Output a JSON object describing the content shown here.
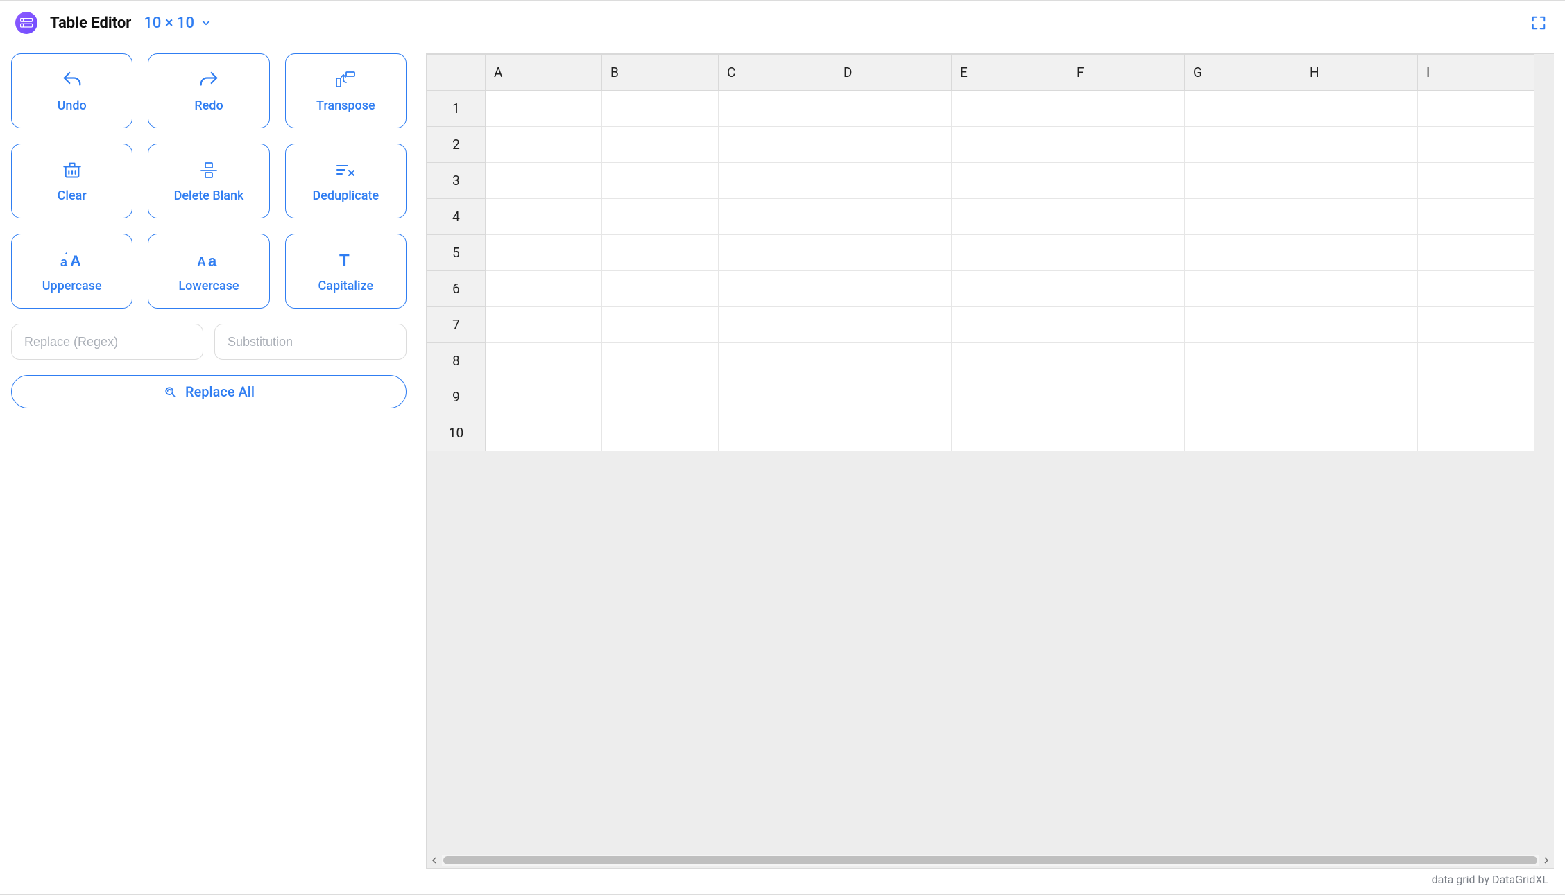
{
  "header": {
    "title": "Table Editor",
    "dims_label": "10 × 10"
  },
  "sidebar": {
    "buttons": {
      "undo": "Undo",
      "redo": "Redo",
      "transpose": "Transpose",
      "clear": "Clear",
      "delete_blank": "Delete Blank",
      "deduplicate": "Deduplicate",
      "uppercase": "Uppercase",
      "lowercase": "Lowercase",
      "capitalize": "Capitalize"
    },
    "replace": {
      "regex_placeholder": "Replace (Regex)",
      "substitution_placeholder": "Substitution",
      "replace_all_label": "Replace All"
    }
  },
  "grid": {
    "columns": [
      "A",
      "B",
      "C",
      "D",
      "E",
      "F",
      "G",
      "H",
      "I"
    ],
    "rows": [
      "1",
      "2",
      "3",
      "4",
      "5",
      "6",
      "7",
      "8",
      "9",
      "10"
    ],
    "cells": {}
  },
  "footer": {
    "credit": "data grid by DataGridXL"
  }
}
